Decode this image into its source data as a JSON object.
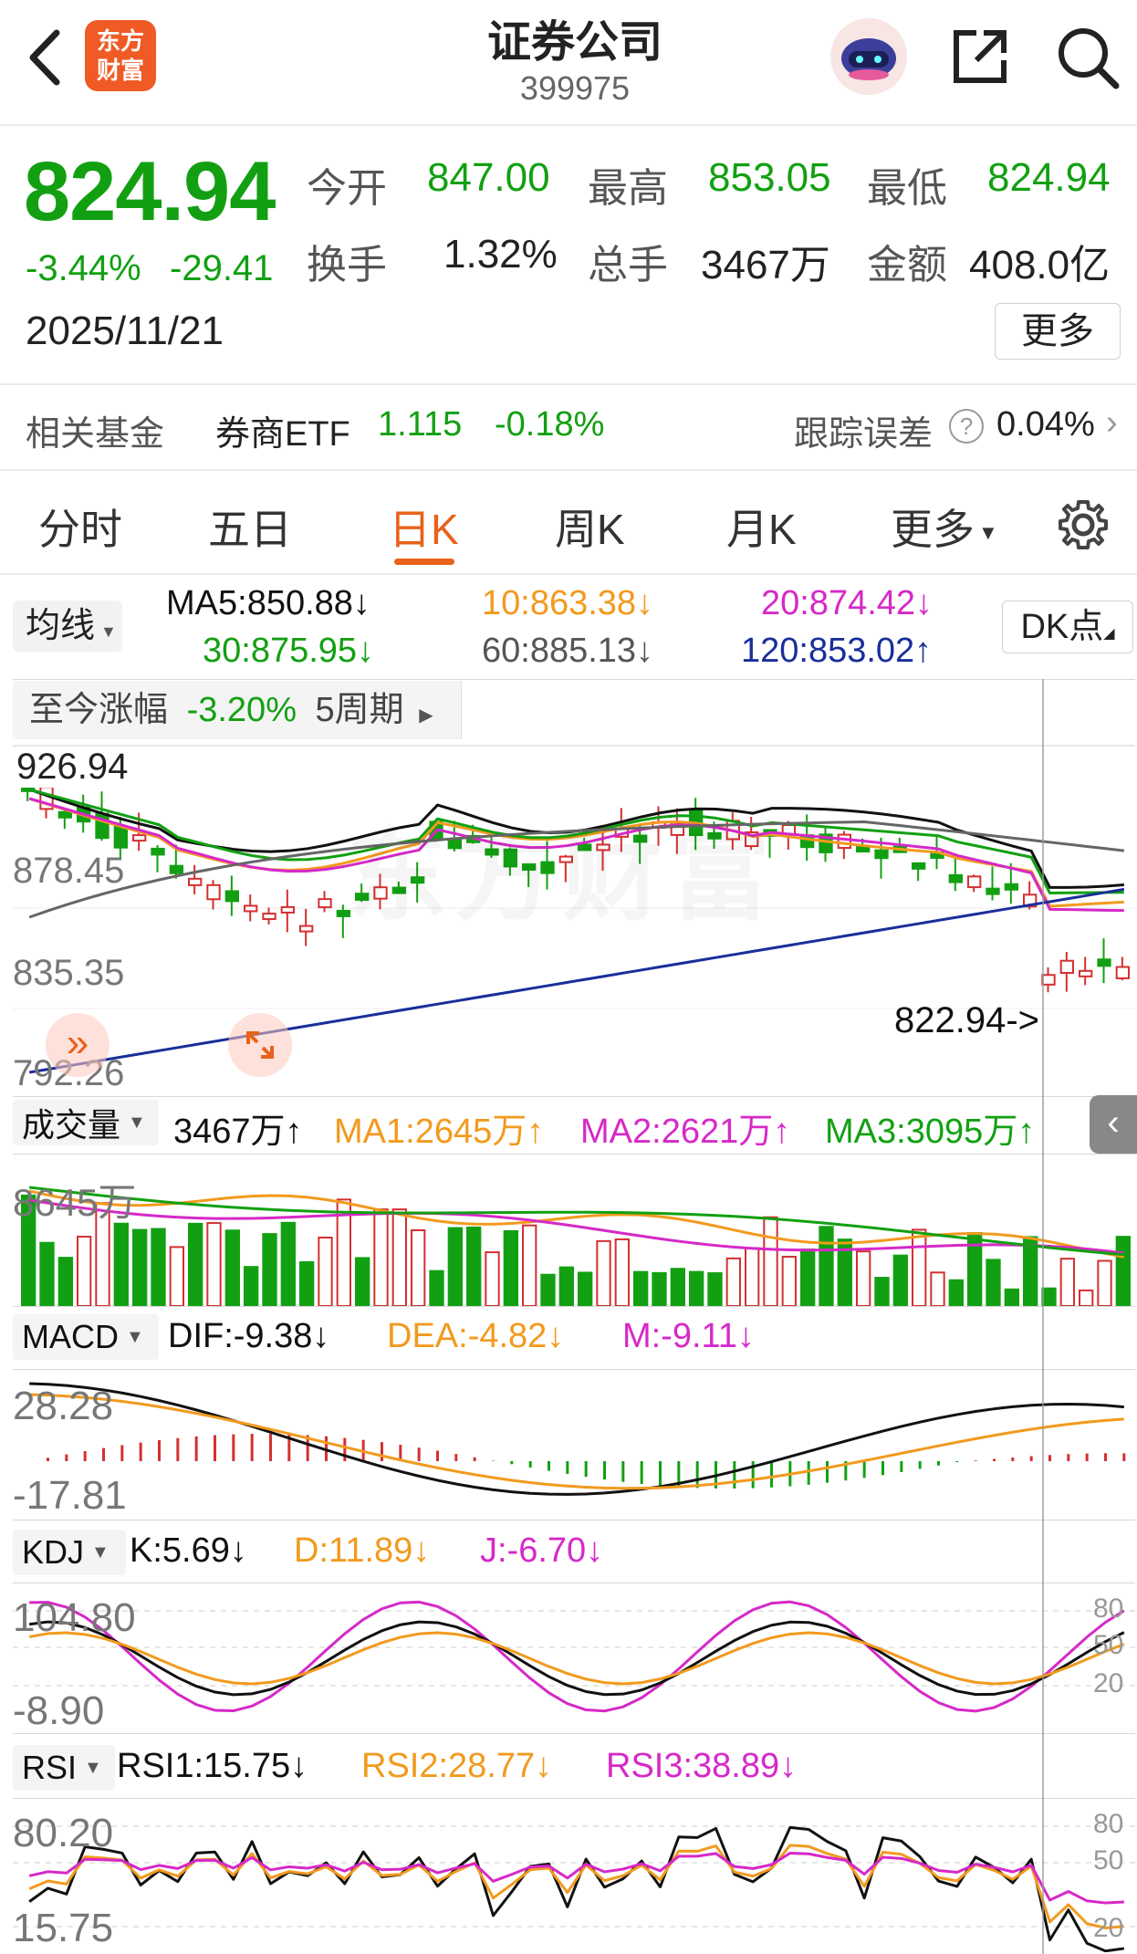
{
  "header": {
    "title": "证券公司",
    "code": "399975",
    "logo_text_1": "东方",
    "logo_text_2": "财富"
  },
  "quote": {
    "price": "824.94",
    "change_pct": "-3.44%",
    "change_abs": "-29.41",
    "date": "2025/11/21",
    "open_label": "今开",
    "open": "847.00",
    "high_label": "最高",
    "high": "853.05",
    "low_label": "最低",
    "low": "824.94",
    "turnover_label": "换手",
    "turnover": "1.32%",
    "volume_label": "总手",
    "volume": "3467万",
    "amount_label": "金额",
    "amount": "408.0亿",
    "more_label": "更多"
  },
  "fund": {
    "label": "相关基金",
    "name": "券商ETF",
    "price": "1.115",
    "change": "-0.18%",
    "tracking_label": "跟踪误差",
    "tracking_value": "0.04%"
  },
  "tabs": [
    {
      "label": "分时"
    },
    {
      "label": "五日"
    },
    {
      "label": "日K"
    },
    {
      "label": "周K"
    },
    {
      "label": "月K"
    },
    {
      "label": "更多"
    }
  ],
  "ma_bar": {
    "selector": "均线",
    "ma5": "MA5:850.88↓",
    "ma10": "10:863.38↓",
    "ma20": "20:874.42↓",
    "ma30": "30:875.95↓",
    "ma60": "60:885.13↓",
    "ma120": "120:853.02↑",
    "dk_label": "DK点"
  },
  "kline": {
    "range_label": "至今涨幅",
    "range_value": "-3.20%",
    "range_period": "5周期",
    "y_labels": [
      "926.94",
      "878.45",
      "835.35",
      "792.26"
    ],
    "last_label": "822.94->"
  },
  "volume_panel": {
    "selector": "成交量",
    "vol": "3467万↑",
    "ma1": "MA1:2645万↑",
    "ma2": "MA2:2621万↑",
    "ma3": "MA3:3095万↑",
    "y_label": "8645万"
  },
  "macd_panel": {
    "selector": "MACD",
    "dif": "DIF:-9.38↓",
    "dea": "DEA:-4.82↓",
    "m": "M:-9.11↓",
    "y_top": "28.28",
    "y_bottom": "-17.81"
  },
  "kdj_panel": {
    "selector": "KDJ",
    "k": "K:5.69↓",
    "d": "D:11.89↓",
    "j": "J:-6.70↓",
    "y_top": "104.80",
    "y_bottom": "-8.90",
    "levels": [
      "80",
      "50",
      "20"
    ]
  },
  "rsi_panel": {
    "selector": "RSI",
    "rsi1": "RSI1:15.75↓",
    "rsi2": "RSI2:28.77↓",
    "rsi3": "RSI3:38.89↓",
    "y_top": "80.20",
    "y_bottom": "15.75",
    "levels": [
      "80",
      "50",
      "20"
    ]
  },
  "colors": {
    "up": "#d43030",
    "down": "#12a012",
    "ma5": "#111111",
    "ma10": "#f29a1e",
    "ma20": "#d629c8",
    "ma30": "#12a012",
    "ma60": "#666666",
    "ma120": "#1a2e9a",
    "active_tab": "#e8621a"
  }
}
